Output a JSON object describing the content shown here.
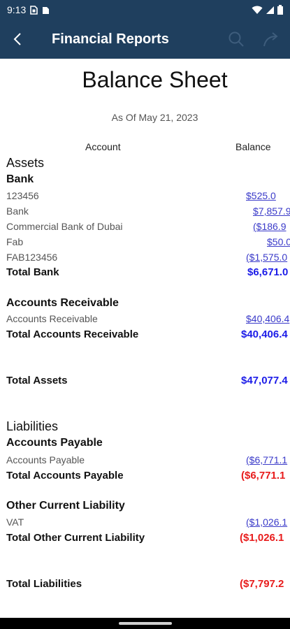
{
  "status": {
    "time": "9:13"
  },
  "header": {
    "title": "Financial Reports"
  },
  "report": {
    "title": "Balance Sheet",
    "date": "As Of May 21, 2023",
    "col_account": "Account",
    "col_balance": "Balance"
  },
  "assets": {
    "heading": "Assets",
    "bank": {
      "heading": "Bank",
      "rows": [
        {
          "label": "123456",
          "value": "$525.0"
        },
        {
          "label": "Bank",
          "value": "$7,857.9"
        },
        {
          "label": "Commercial Bank of Dubai",
          "value": "($186.9"
        },
        {
          "label": "Fab",
          "value": "$50.0"
        },
        {
          "label": "FAB123456",
          "value": "($1,575.0"
        }
      ],
      "total_label": "Total Bank",
      "total_value": "$6,671.0"
    },
    "ar": {
      "heading": "Accounts Receivable",
      "rows": [
        {
          "label": "Accounts Receivable",
          "value": "$40,406.4"
        }
      ],
      "total_label": "Total Accounts Receivable",
      "total_value": "$40,406.4"
    },
    "total_label": "Total Assets",
    "total_value": "$47,077.4"
  },
  "liabilities": {
    "heading": "Liabilities",
    "ap": {
      "heading": "Accounts Payable",
      "rows": [
        {
          "label": "Accounts Payable",
          "value": "($6,771.1"
        }
      ],
      "total_label": "Total Accounts Payable",
      "total_value": "($6,771.1"
    },
    "ocl": {
      "heading": "Other Current Liability",
      "rows": [
        {
          "label": "VAT",
          "value": "($1,026.1"
        }
      ],
      "total_label": "Total Other Current Liability",
      "total_value": "($1,026.1"
    },
    "total_label": "Total Liabilities",
    "total_value": "($7,797.2"
  }
}
